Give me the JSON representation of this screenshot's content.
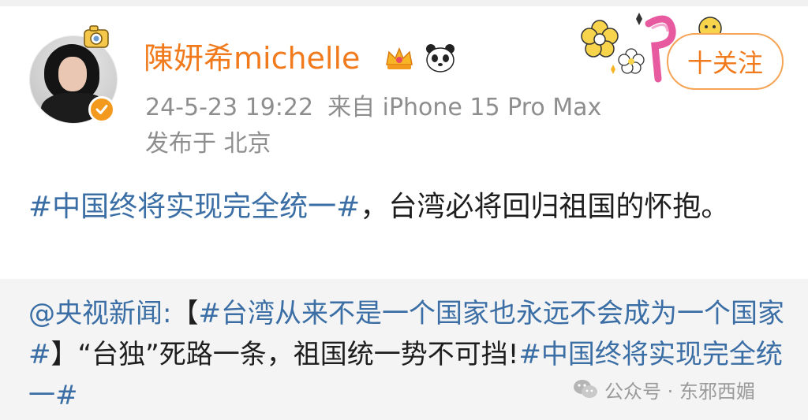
{
  "user": {
    "name": "陳妍希michelle",
    "badges": [
      "crown-icon",
      "panda-icon"
    ],
    "verified": true,
    "avatar_badge": "camera-icon"
  },
  "post": {
    "date": "24-5-23 19:22",
    "source": "来自 iPhone 15 Pro Max",
    "location": "发布于 北京",
    "hashtag": "#中国终将实现完全统一#",
    "text": "，台湾必将回归祖国的怀抱。"
  },
  "follow": {
    "label": "十关注"
  },
  "repost": {
    "mention": "@央视新闻:",
    "bracket_open": "【",
    "hashtag1": "#台湾从来不是一个国家也永远不会成为一个国家#",
    "bracket_close": "】",
    "body": "“台独”死路一条，祖国统一势不可挡!",
    "hashtag2": "#中国终将实现完全统一#"
  },
  "watermark": {
    "text": "公众号 · 东邪西媚",
    "icon": "wechat-icon"
  },
  "colors": {
    "name": "#f07a1c",
    "hashtag": "#3a6ea5",
    "meta": "#8e8e8e",
    "repost_bg": "#f4f4f4",
    "follow_border": "#f5a455"
  }
}
